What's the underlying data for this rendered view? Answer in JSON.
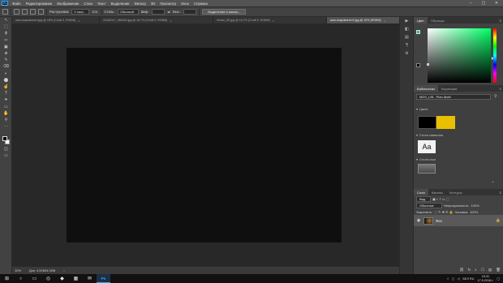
{
  "menubar": {
    "app_icon": "Ps",
    "items": [
      "Файл",
      "Редактирование",
      "Изображение",
      "Слои",
      "Текст",
      "Выделение",
      "Фильтр",
      "3D",
      "Просмотр",
      "Окно",
      "Справка"
    ],
    "window_controls": [
      "–",
      "▢",
      "✕"
    ]
  },
  "options": {
    "feather_label": "Растушевка:",
    "feather_value": "0 пикс.",
    "antialias_label": "Сгл.",
    "style_label": "Стиль:",
    "style_value": "Обычный",
    "width_label": "Шир.:",
    "height_label": "Выс.:",
    "refine_button": "Выделение и маска..."
  },
  "tabs": [
    {
      "label": "шея-покровнгатт.jpg @ 16% (Слой 0, RGB/8)",
      "active": false
    },
    {
      "label": "20180117_080433.jpg @ 16,7% (Слой 0, RGB/8)",
      "active": false
    },
    {
      "label": "Vector_50.jpg @ 16,7% (Слой 0, RGB/8)",
      "active": false
    },
    {
      "label": "шея-покровнгатт2.jpg @ 10% (RGB/8)",
      "active": true
    }
  ],
  "tools": [
    "↖",
    "⬚",
    "ϕ",
    "✂",
    "▣",
    "⊕",
    "✎",
    "⌫",
    "◐",
    "⬤",
    "☝",
    "T",
    "➤",
    "▭",
    "✋",
    "⚲"
  ],
  "status": {
    "zoom": "10%",
    "doc_info": "Док: 4,92М/4,92М"
  },
  "dock_icons": [
    "▶",
    "◧",
    "▤",
    "¶",
    "⚙"
  ],
  "color_panel": {
    "tabs": [
      "Цвет",
      "Образцы"
    ],
    "fg_color": "#00d26a",
    "bg_color": "#000000"
  },
  "libraries": {
    "tabs": [
      "Библиотеки",
      "Коррекция"
    ],
    "selected": "MDS_LIB - Plan Abell",
    "colors_title": "Цвета",
    "swatch_a": "#000000",
    "swatch_b": "#e8c000",
    "styles_title": "Стили символов",
    "styles_sample": "Aa",
    "layer_styles_title": "Стили слоя"
  },
  "layers": {
    "tabs": [
      "Слои",
      "Каналы",
      "Контуры"
    ],
    "filter_kind": "Вид",
    "blend_mode": "Обычные",
    "opacity_label": "Непрозрачность:",
    "opacity_value": "100%",
    "lock_label": "Закрепить:",
    "fill_label": "Заливка:",
    "fill_value": "100%",
    "items": [
      {
        "name": "Фон",
        "visible": true,
        "locked": true
      }
    ],
    "footer_icons": [
      "⛓",
      "fx",
      "◐",
      "☐",
      "▤",
      "🗑"
    ]
  },
  "taskbar": {
    "icons": [
      "⊞",
      "○",
      "▭",
      "◎",
      "◆",
      "▦",
      "✉",
      "Ps"
    ],
    "lang": "БЕЛ",
    "region": "RU",
    "time": "16:31",
    "date": "17.5.2018 г."
  }
}
